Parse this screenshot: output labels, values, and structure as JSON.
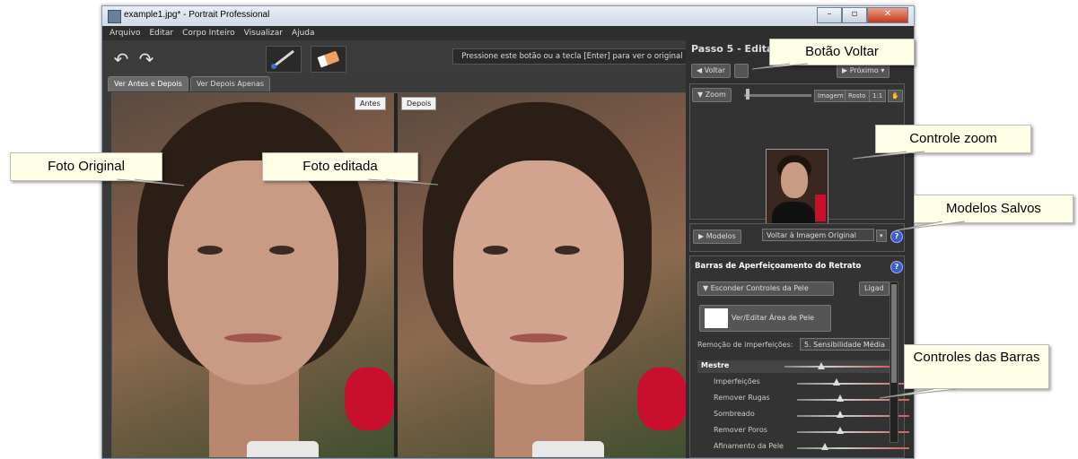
{
  "window": {
    "title": "example1.jpg* - Portrait Professional"
  },
  "menu": [
    "Arquivo",
    "Editar",
    "Corpo Inteiro",
    "Visualizar",
    "Ajuda"
  ],
  "toolbar": {
    "hint": "Pressione este botão ou a tecla [Enter] para ver o original"
  },
  "tabs": [
    "Ver Antes e Depois",
    "Ver Depois Apenas"
  ],
  "viewer": {
    "before_label": "Antes",
    "after_label": "Depois"
  },
  "panel": {
    "step_title": "Passo 5 - Edita",
    "back_label": "Voltar",
    "next_label": "Próximo",
    "zoom": {
      "label": "Zoom",
      "buttons": [
        "Imagem",
        "Rosto",
        "1:1"
      ]
    },
    "models": {
      "label": "Modelos",
      "selected": "Voltar à Imagem Original"
    },
    "bars": {
      "title": "Barras de Aperfeiçoamento do Retrato",
      "skin_toggle": "Esconder Controles da Pele",
      "on_label": "Ligad",
      "skin_area_button": "Ver/Editar Área de Pele",
      "imperfections_label": "Remoção de imperfeições:",
      "imperfections_value": "5. Sensibilidade Média",
      "master_label": "Mestre",
      "master_level": 0.35,
      "sliders": [
        {
          "label": "Imperfeições",
          "level": 0.35
        },
        {
          "label": "Remover Rugas",
          "level": 0.38
        },
        {
          "label": "Sombreado",
          "level": 0.38
        },
        {
          "label": "Remover Poros",
          "level": 0.38
        },
        {
          "label": "Afinamento da Pele",
          "level": 0.25
        }
      ]
    }
  },
  "callouts": {
    "original": "Foto Original",
    "edited": "Foto editada",
    "back": "Botão Voltar",
    "zoom": "Controle zoom",
    "models": "Modelos Salvos",
    "bars": "Controles das Barras"
  }
}
